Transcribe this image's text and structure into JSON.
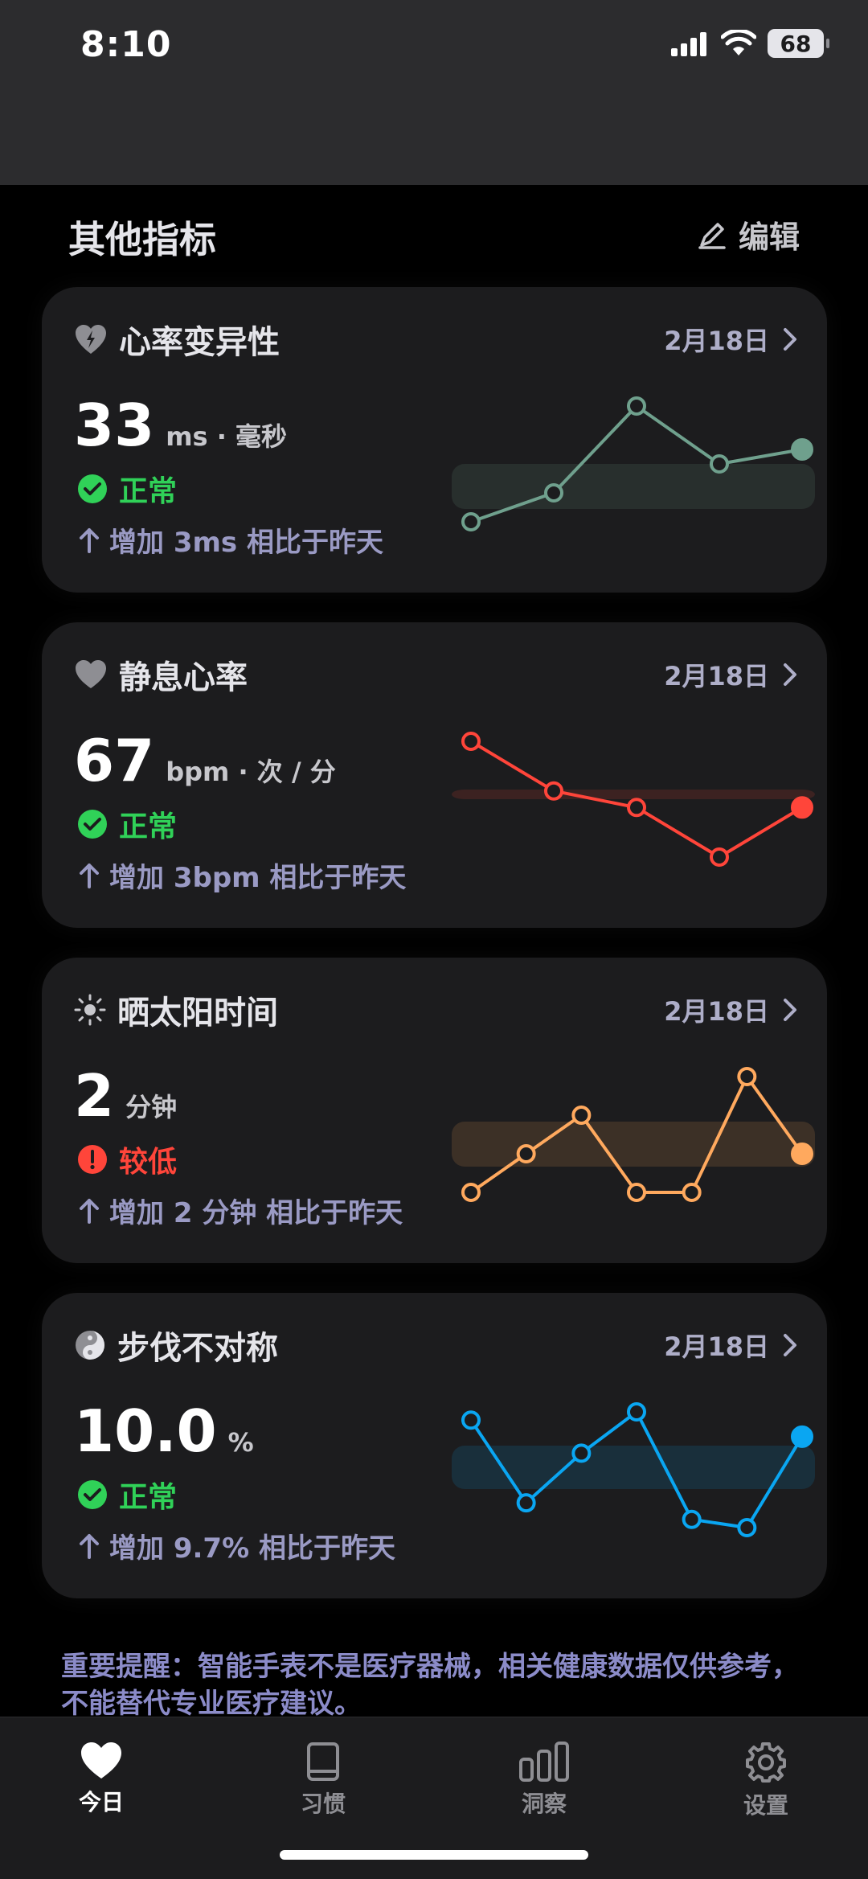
{
  "status_bar": {
    "time": "8:10",
    "battery": "68"
  },
  "section": {
    "title": "其他指标",
    "edit_label": "编辑"
  },
  "cards": [
    {
      "title": "心率变异性",
      "icon": "heart-bolt-icon",
      "date": "2月18日",
      "value": "33",
      "unit": "ms · 毫秒",
      "status": "正常",
      "status_type": "ok",
      "change": "增加 3ms 相比于昨天",
      "accent": "#6fa08d",
      "chart_data": {
        "type": "line",
        "values": [
          3,
          4,
          7,
          5,
          5.5
        ]
      }
    },
    {
      "title": "静息心率",
      "icon": "heart-icon",
      "date": "2月18日",
      "value": "67",
      "unit": "bpm · 次 / 分",
      "status": "正常",
      "status_type": "ok",
      "change": "增加 3bpm 相比于昨天",
      "accent": "#ff453a",
      "chart_data": {
        "type": "line",
        "values": [
          71,
          68,
          67,
          64,
          67
        ]
      }
    },
    {
      "title": "晒太阳时间",
      "icon": "sun-icon",
      "date": "2月18日",
      "value": "2",
      "unit": "分钟",
      "status": "较低",
      "status_type": "low",
      "change": "增加 2 分钟 相比于昨天",
      "accent": "#ffa95e",
      "chart_data": {
        "type": "line",
        "values": [
          0,
          1,
          2,
          0,
          0,
          3,
          1
        ]
      }
    },
    {
      "title": "步伐不对称",
      "icon": "yin-yang-icon",
      "date": "2月18日",
      "value": "10.0",
      "unit": "%",
      "status": "正常",
      "status_type": "ok",
      "change": "增加 9.7% 相比于昨天",
      "accent": "#0aa6f2",
      "chart_data": {
        "type": "line",
        "values": [
          11,
          6,
          9,
          11.5,
          5,
          4.5,
          10
        ]
      }
    }
  ],
  "notice": "重要提醒：智能手表不是医疗器械，相关健康数据仅供参考，不能替代专业医疗建议。",
  "tabs": [
    {
      "label": "今日",
      "icon": "heart-icon",
      "active": true
    },
    {
      "label": "习惯",
      "icon": "book-icon",
      "active": false
    },
    {
      "label": "洞察",
      "icon": "bar-chart-icon",
      "active": false
    },
    {
      "label": "设置",
      "icon": "gear-icon",
      "active": false
    }
  ]
}
